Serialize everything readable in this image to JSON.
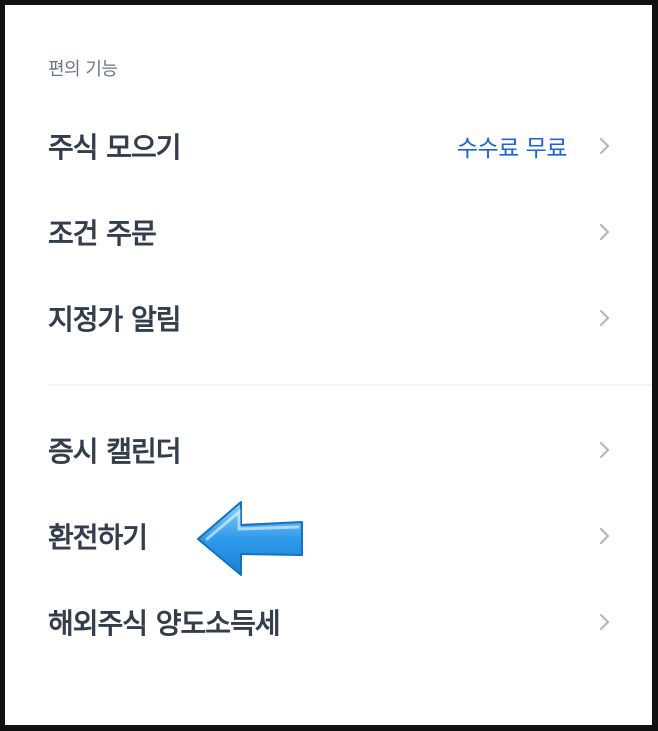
{
  "section": {
    "title": "편의 기능"
  },
  "items": [
    {
      "label": "주식 모으기",
      "extra": "수수료 무료"
    },
    {
      "label": "조건 주문",
      "extra": ""
    },
    {
      "label": "지정가 알림",
      "extra": ""
    },
    {
      "label": "증시 캘린더",
      "extra": ""
    },
    {
      "label": "환전하기",
      "extra": ""
    },
    {
      "label": "해외주식 양도소득세",
      "extra": ""
    }
  ],
  "icons": {
    "chevron": "chevron-right-icon",
    "pointer": "left-arrow-icon"
  },
  "colors": {
    "accent": "#1b64da",
    "text": "#333d4b",
    "subtext": "#6b7684",
    "arrow": "#2f9be9"
  }
}
